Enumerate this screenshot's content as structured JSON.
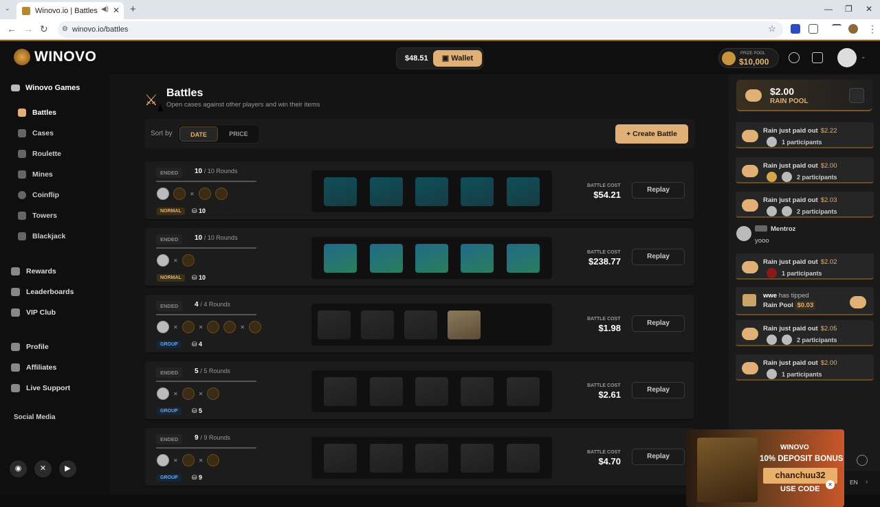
{
  "browser": {
    "tab_title": "Winovo.io | Battles",
    "url": "winovo.io/battles"
  },
  "topbar": {
    "logo_text": "WINOVO",
    "balance": "$48.51",
    "wallet_label": "Wallet",
    "prize_pool_label": "PRIZE POOL",
    "prize_pool_value": "$10,000"
  },
  "sidebar": {
    "section_title": "Winovo Games",
    "games": [
      "Battles",
      "Cases",
      "Roulette",
      "Mines",
      "Coinflip",
      "Towers",
      "Blackjack"
    ],
    "extras": [
      "Rewards",
      "Leaderboards",
      "VIP Club"
    ],
    "account": [
      "Profile",
      "Affiliates",
      "Live Support"
    ],
    "social_title": "Social Media",
    "active": "Battles"
  },
  "main": {
    "title": "Battles",
    "subtitle": "Open cases against other players and win their items",
    "sort_label": "Sort by",
    "sort_options": [
      "DATE",
      "PRICE"
    ],
    "sort_active": "DATE",
    "create_label": "Create Battle",
    "cost_label": "BATTLE COST",
    "replay_label": "Replay",
    "ended_label": "ENDED",
    "battles": [
      {
        "rounds_done": "10",
        "rounds_total": "/ 10 Rounds",
        "mode": "NORMAL",
        "count": "10",
        "cost": "$54.21"
      },
      {
        "rounds_done": "10",
        "rounds_total": "/ 10 Rounds",
        "mode": "NORMAL",
        "count": "10",
        "cost": "$238.77"
      },
      {
        "rounds_done": "4",
        "rounds_total": "/ 4 Rounds",
        "mode": "GROUP",
        "count": "4",
        "cost": "$1.98"
      },
      {
        "rounds_done": "5",
        "rounds_total": "/ 5 Rounds",
        "mode": "GROUP",
        "count": "5",
        "cost": "$2.61"
      },
      {
        "rounds_done": "9",
        "rounds_total": "/ 9 Rounds",
        "mode": "GROUP",
        "count": "9",
        "cost": "$4.70"
      }
    ]
  },
  "chat": {
    "rain_amount": "$2.00",
    "rain_label": "RAIN POOL",
    "rain_msg": "Rain just paid out",
    "messages": [
      {
        "amount": "$2.22",
        "participants": "1 participants"
      },
      {
        "amount": "$2.00",
        "participants": "2 participants"
      },
      {
        "amount": "$2.03",
        "participants": "2 participants"
      },
      {
        "amount": "$2.02",
        "participants": "1 participants"
      },
      {
        "amount": "$2.05",
        "participants": "2 participants"
      },
      {
        "amount": "$2.00",
        "participants": "1 participants"
      }
    ],
    "user_name": "Mentroz",
    "user_text": "yooo",
    "tip_user": "wwe",
    "tip_text": "has tipped",
    "tip_target": "Rain Pool",
    "tip_amount": "$0.03",
    "lang": "EN"
  },
  "promo": {
    "brand": "WINOVO",
    "deposit_bonus": "10% DEPOSIT BONUS",
    "code": "chanchuu32",
    "use_code": "USE CODE"
  }
}
